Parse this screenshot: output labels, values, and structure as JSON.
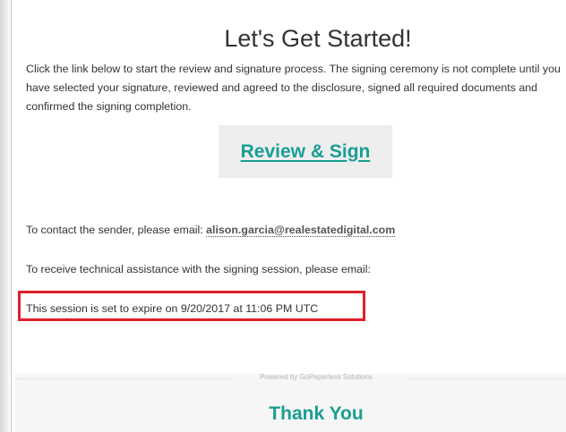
{
  "header": {
    "title": "Let's Get Started!",
    "intro": "Click the link below to start the review and signature process. The signing ceremony is not complete until you have selected your signature, reviewed and agreed to the disclosure, signed all required documents and confirmed the signing completion."
  },
  "review": {
    "link_label": "Review & Sign"
  },
  "contact": {
    "prefix": "To contact the sender, please email: ",
    "email": "alison.garcia@realestatedigital.com"
  },
  "tech_support": {
    "text": "To receive technical assistance with the signing session, please email:"
  },
  "session": {
    "expire_text": "This session is set to expire on 9/20/2017 at 11:06 PM UTC"
  },
  "footer": {
    "powered_by": "Powered by GoPaperless Solutions",
    "thanks": "Thank You"
  },
  "colors": {
    "accent": "#1a9e94",
    "highlight_box": "#e0202a",
    "text": "#333333"
  }
}
